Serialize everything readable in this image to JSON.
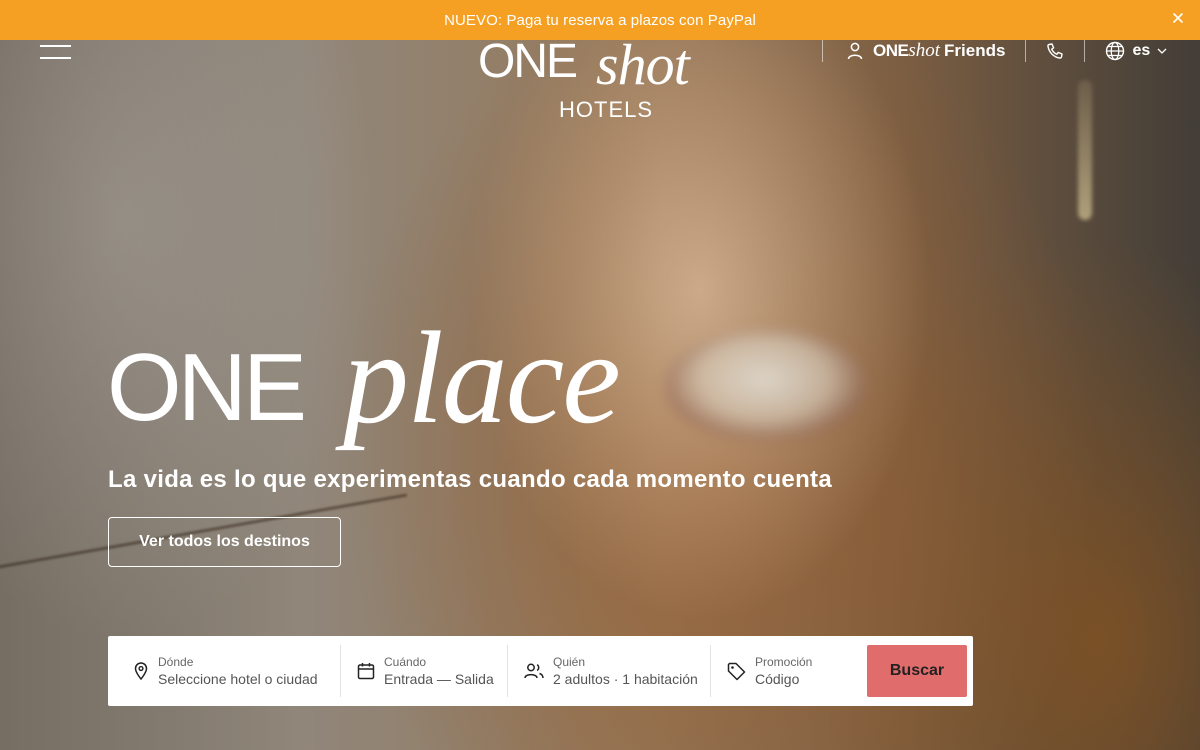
{
  "banner": {
    "text": "NUEVO: Paga tu reserva a plazos con PayPal",
    "background": "#f5a023"
  },
  "header": {
    "logo": {
      "one": "ONE",
      "shot": "shot",
      "hotels": "HOTELS"
    },
    "friends": {
      "one": "ONE",
      "shot": "shot",
      "word": "Friends"
    },
    "language": "es"
  },
  "hero": {
    "title_one": "ONE",
    "title_place": "place",
    "subtitle": "La vida es lo que experimentas cuando cada momento cuenta",
    "cta_label": "Ver todos los destinos"
  },
  "search": {
    "where": {
      "label": "Dónde",
      "value": "Seleccione hotel o ciudad"
    },
    "when": {
      "label": "Cuándo",
      "value": "Entrada — Salida"
    },
    "who": {
      "label": "Quién",
      "value": "2 adultos · 1 habitación"
    },
    "promo": {
      "label": "Promoción",
      "value": "Código"
    },
    "button_label": "Buscar",
    "button_color": "#e06c6b"
  },
  "icons": [
    "close-icon",
    "menu-icon",
    "user-icon",
    "phone-icon",
    "globe-icon",
    "chevron-down-icon",
    "location-pin-icon",
    "calendar-icon",
    "guests-icon",
    "tag-icon"
  ]
}
